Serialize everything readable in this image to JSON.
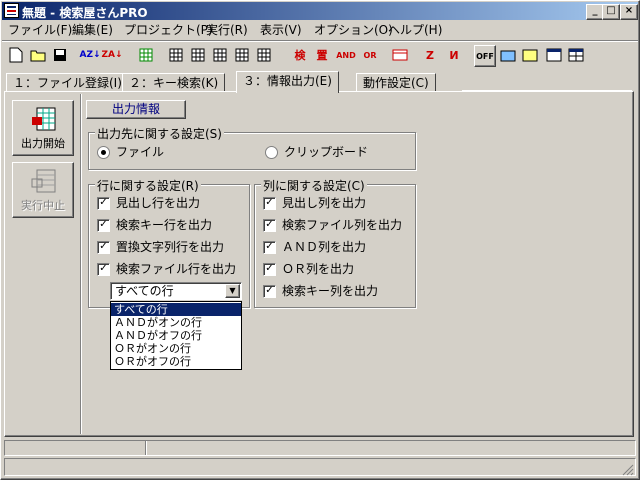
{
  "window": {
    "title": "無題 - 検索屋さんPRO",
    "min": "_",
    "max": "□",
    "close": "×"
  },
  "menu": [
    "ファイル(F)",
    "編集(E)",
    "プロジェクト(P)",
    "実行(R)",
    "表示(V)",
    "オプション(O)",
    "ヘルプ(H)"
  ],
  "toolbar": {
    "and_label": "AND",
    "or_label": "OR",
    "off_label": "OFF"
  },
  "tabs": [
    "１：ファイル登録(I)",
    "２：キー検索(K)",
    "３：情報出力(E)",
    "動作設定(C)"
  ],
  "left": {
    "start_label": "出力開始",
    "stop_label": "実行中止"
  },
  "section_header": "出力情報",
  "output_dest": {
    "title": "出力先に関する設定(S)",
    "options": [
      {
        "label": "ファイル",
        "selected": true
      },
      {
        "label": "クリップボード",
        "selected": false
      }
    ]
  },
  "row_settings": {
    "title": "行に関する設定(R)",
    "items": [
      {
        "label": "見出し行を出力",
        "checked": true
      },
      {
        "label": "検索キー行を出力",
        "checked": true
      },
      {
        "label": "置換文字列行を出力",
        "checked": true
      },
      {
        "label": "検索ファイル行を出力",
        "checked": true
      }
    ],
    "dropdown": {
      "value": "すべての行",
      "options": [
        "すべての行",
        "ＡＮＤがオンの行",
        "ＡＮＤがオフの行",
        "ＯＲがオンの行",
        "ＯＲがオフの行"
      ]
    }
  },
  "col_settings": {
    "title": "列に関する設定(C)",
    "items": [
      {
        "label": "見出し列を出力",
        "checked": true
      },
      {
        "label": "検索ファイル列を出力",
        "checked": true
      },
      {
        "label": "ＡＮＤ列を出力",
        "checked": true
      },
      {
        "label": "ＯＲ列を出力",
        "checked": true
      },
      {
        "label": "検索キー列を出力",
        "checked": true
      }
    ]
  }
}
